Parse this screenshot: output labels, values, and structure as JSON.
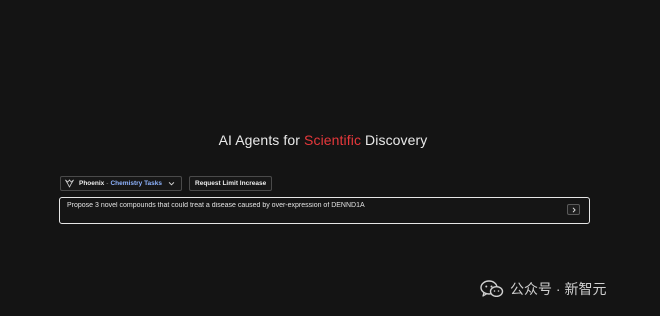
{
  "hero": {
    "title_before": "AI Agents for ",
    "title_accent": "Scientific",
    "title_after": " Discovery"
  },
  "toolbar": {
    "agent_name": "Phoenix",
    "agent_separator": "-",
    "task_name": "Chemistry Tasks",
    "limit_button_label": "Request Limit Increase"
  },
  "prompt": {
    "value": "Propose 3 novel compounds that could treat a disease caused by over-expression of DENND1A"
  },
  "watermark": {
    "text": "公众号 · 新智元"
  },
  "icons": {
    "agent_logo": "phoenix-logo-icon",
    "dropdown": "chevron-down-icon",
    "submit": "chevron-right-icon",
    "watermark": "wechat-icon"
  },
  "colors": {
    "background": "#141414",
    "accent": "#e5383b",
    "task_link": "#8fb4ff"
  }
}
